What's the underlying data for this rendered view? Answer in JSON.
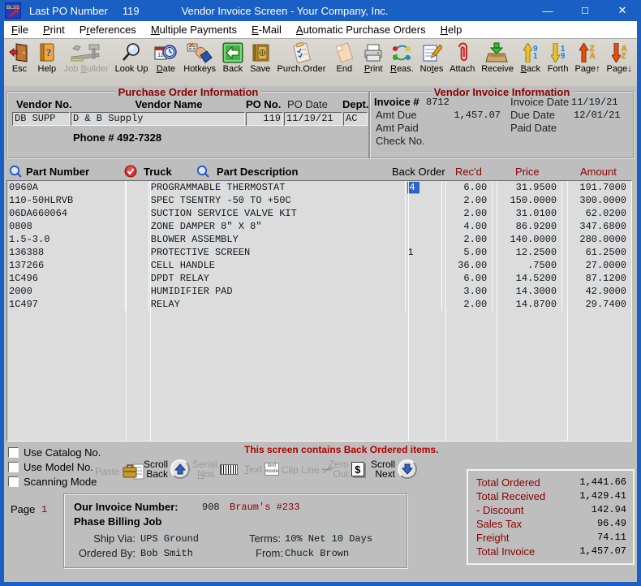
{
  "window": {
    "icon_label": "BLSS",
    "pre_title_label": "Last PO Number",
    "pre_title_value": "119",
    "title": "Vendor Invoice Screen - Your Company, Inc."
  },
  "menu": {
    "items": [
      {
        "label": "File",
        "accel": "F"
      },
      {
        "label": "Print",
        "accel": "P"
      },
      {
        "label": "Preferences",
        "accel": "r"
      },
      {
        "label": "Multiple Payments",
        "accel": "M"
      },
      {
        "label": "E-Mail",
        "accel": "E"
      },
      {
        "label": "Automatic Purchase Orders",
        "accel": "A"
      },
      {
        "label": "Help",
        "accel": "H"
      }
    ]
  },
  "toolbar": {
    "buttons": [
      {
        "label": "Esc",
        "icon": "door-icon"
      },
      {
        "label": "Help",
        "icon": "help-book-icon"
      },
      {
        "label": "Job Builder",
        "accel": "B",
        "icon": "tools-icon",
        "disabled": true
      },
      {
        "label": "Look Up",
        "icon": "magnifier-icon"
      },
      {
        "label": "Date",
        "accel": "D",
        "icon": "calendar-clock-icon"
      },
      {
        "label": "Hotkeys",
        "icon": "hand-keyboard-icon"
      },
      {
        "label": "Back",
        "icon": "green-back-arrow-icon"
      },
      {
        "label": "Save",
        "icon": "safe-icon"
      },
      {
        "label": "Purch.Order",
        "icon": "clipboard-icon"
      },
      {
        "label": "End",
        "icon": "blank-page-icon"
      },
      {
        "label": "Print",
        "accel": "P",
        "icon": "printer-icon"
      },
      {
        "label": "Reas.",
        "accel": "R",
        "icon": "cycle-arrows-icon"
      },
      {
        "label": "Notes",
        "accel": "t",
        "icon": "notepad-icon"
      },
      {
        "label": "Attach",
        "icon": "paperclip-icon"
      },
      {
        "label": "Receive",
        "icon": "receive-box-icon"
      },
      {
        "label": "Back",
        "accel": "B",
        "icon": "sort-9-1-up-icon"
      },
      {
        "label": "Forth",
        "accel": "F",
        "icon": "sort-1-9-down-icon"
      },
      {
        "label": "Page↑",
        "icon": "page-up-za-icon"
      },
      {
        "label": "Page↓",
        "icon": "page-down-az-icon"
      }
    ]
  },
  "po_info": {
    "title": "Purchase Order Information",
    "vendor_no_label": "Vendor No.",
    "vendor_no": "DB SUPP",
    "vendor_name_label": "Vendor Name",
    "vendor_name": "D & B Supply",
    "po_no_label": "PO No.",
    "po_no": "119",
    "po_date_label": "PO Date",
    "po_date": "11/19/21",
    "dept_label": "Dept.",
    "dept": "AC",
    "phone": "Phone # 492-7328"
  },
  "invoice_info": {
    "title": "Vendor Invoice Information",
    "invoice_no_label": "Invoice #",
    "invoice_no": "8712",
    "invoice_date_label": "Invoice Date",
    "invoice_date": "11/19/21",
    "amt_due_label": "Amt Due",
    "amt_due": "1,457.07",
    "due_date_label": "Due Date",
    "due_date": "12/01/21",
    "amt_paid_label": "Amt Paid",
    "amt_paid": "",
    "paid_date_label": "Paid Date",
    "paid_date": "",
    "check_no_label": "Check No.",
    "check_no": ""
  },
  "grid": {
    "headers": {
      "part_number": "Part Number",
      "truck": "Truck",
      "part_description": "Part Description",
      "back_order": "Back Order",
      "recd": "Rec'd",
      "price": "Price",
      "amount": "Amount"
    },
    "rows": [
      {
        "part": "0960A",
        "truck": "",
        "desc": "PROGRAMMABLE THERMOSTAT",
        "back_order": "4",
        "selected": true,
        "recd": "6.00",
        "price": "31.9500",
        "amount": "191.7000"
      },
      {
        "part": "110-50HLRVB",
        "truck": "",
        "desc": "SPEC TSENTRY -50 TO +50C",
        "back_order": "",
        "recd": "2.00",
        "price": "150.0000",
        "amount": "300.0000"
      },
      {
        "part": "06DA660064",
        "truck": "",
        "desc": "SUCTION SERVICE VALVE KIT",
        "back_order": "",
        "recd": "2.00",
        "price": "31.0100",
        "amount": "62.0200"
      },
      {
        "part": "0808",
        "truck": "",
        "desc": "ZONE DAMPER 8\" X 8\"",
        "back_order": "",
        "recd": "4.00",
        "price": "86.9200",
        "amount": "347.6800"
      },
      {
        "part": "1.5-3.0",
        "truck": "",
        "desc": "BLOWER ASSEMBLY",
        "back_order": "",
        "recd": "2.00",
        "price": "140.0000",
        "amount": "280.0000"
      },
      {
        "part": "136388",
        "truck": "",
        "desc": "PROTECTIVE SCREEN",
        "back_order": "1",
        "recd": "5.00",
        "price": "12.2500",
        "amount": "61.2500"
      },
      {
        "part": "137266",
        "truck": "",
        "desc": "CELL HANDLE",
        "back_order": "",
        "recd": "36.00",
        "price": ".7500",
        "amount": "27.0000"
      },
      {
        "part": "1C496",
        "truck": "",
        "desc": "DPDT RELAY",
        "back_order": "",
        "recd": "6.00",
        "price": "14.5200",
        "amount": "87.1200"
      },
      {
        "part": "2000",
        "truck": "",
        "desc": "HUMIDIFIER PAD",
        "back_order": "",
        "recd": "3.00",
        "price": "14.3000",
        "amount": "42.9000"
      },
      {
        "part": "1C497",
        "truck": "",
        "desc": "RELAY",
        "back_order": "",
        "recd": "2.00",
        "price": "14.8700",
        "amount": "29.7400"
      }
    ]
  },
  "options": {
    "checkboxes": [
      {
        "label": "Use Catalog No.",
        "checked": false
      },
      {
        "label": "Use Model No.",
        "checked": false
      },
      {
        "label": "Scanning Mode",
        "checked": false
      }
    ]
  },
  "actions": {
    "paste": {
      "label": "Paste",
      "disabled": true
    },
    "scroll_back": {
      "label": "Scroll\nBack",
      "disabled": false
    },
    "serial_nos": {
      "label": "Serial\nNos.",
      "accel": "N",
      "disabled": true
    },
    "text": {
      "label": "Text",
      "accel": "T",
      "disabled": true
    },
    "clip_line": {
      "label": "Clip Line",
      "disabled": true
    },
    "zero_out": {
      "label": "Zero\nOut",
      "accel": "Z",
      "disabled": true
    },
    "scroll_next": {
      "label": "Scroll\nNext",
      "disabled": false
    }
  },
  "message": "This screen contains Back Ordered items.",
  "page": {
    "label": "Page",
    "number": "1"
  },
  "footer": {
    "our_invoice_label": "Our Invoice Number:",
    "our_invoice_no": "908",
    "customer_ref": "Braum's #233",
    "phase_label": "Phase Billing Job",
    "ship_via_label": "Ship Via:",
    "ship_via": "UPS Ground",
    "terms_label": "Terms:",
    "terms": "10% Net 10 Days",
    "ordered_by_label": "Ordered By:",
    "ordered_by": "Bob Smith",
    "from_label": "From:",
    "from": "Chuck Brown"
  },
  "totals": {
    "rows": [
      {
        "label": "Total Ordered",
        "value": "1,441.66"
      },
      {
        "label": "Total Received",
        "value": "1,429.41"
      },
      {
        "label": "- Discount",
        "value": "142.94"
      },
      {
        "label": "Sales Tax",
        "value": "96.49"
      },
      {
        "label": "Freight",
        "value": "74.11"
      },
      {
        "label": "Total Invoice",
        "value": "1,457.07"
      }
    ]
  },
  "colors": {
    "titlebar_blue": "#1a60c4",
    "heading_maroon": "#8b0000",
    "alert_red": "#b40000",
    "selection_blue": "#2f63c5",
    "window_gray": "#bebebe"
  }
}
